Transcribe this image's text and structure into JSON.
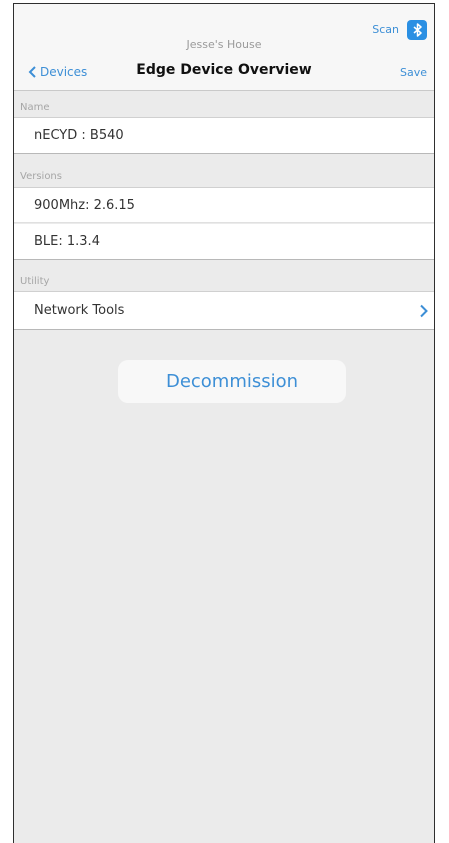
{
  "header": {
    "subtitle": "Jesse's House",
    "title": "Edge Device Overview",
    "back_label": "Devices",
    "save_label": "Save",
    "scan_label": "Scan"
  },
  "sections": {
    "name": {
      "label": "Name",
      "value": "nECYD : B540"
    },
    "versions": {
      "label": "Versions",
      "rows": [
        "900Mhz: 2.6.15",
        "BLE: 1.3.4"
      ]
    },
    "utility": {
      "label": "Utility",
      "rows": [
        "Network Tools"
      ]
    }
  },
  "decommission_label": "Decommission",
  "colors": {
    "accent": "#3d8fd6",
    "background": "#ebebeb",
    "bluetooth_badge": "#2a8fe3"
  },
  "icons": [
    "chevron-left-icon",
    "bluetooth-icon",
    "chevron-right-icon"
  ]
}
